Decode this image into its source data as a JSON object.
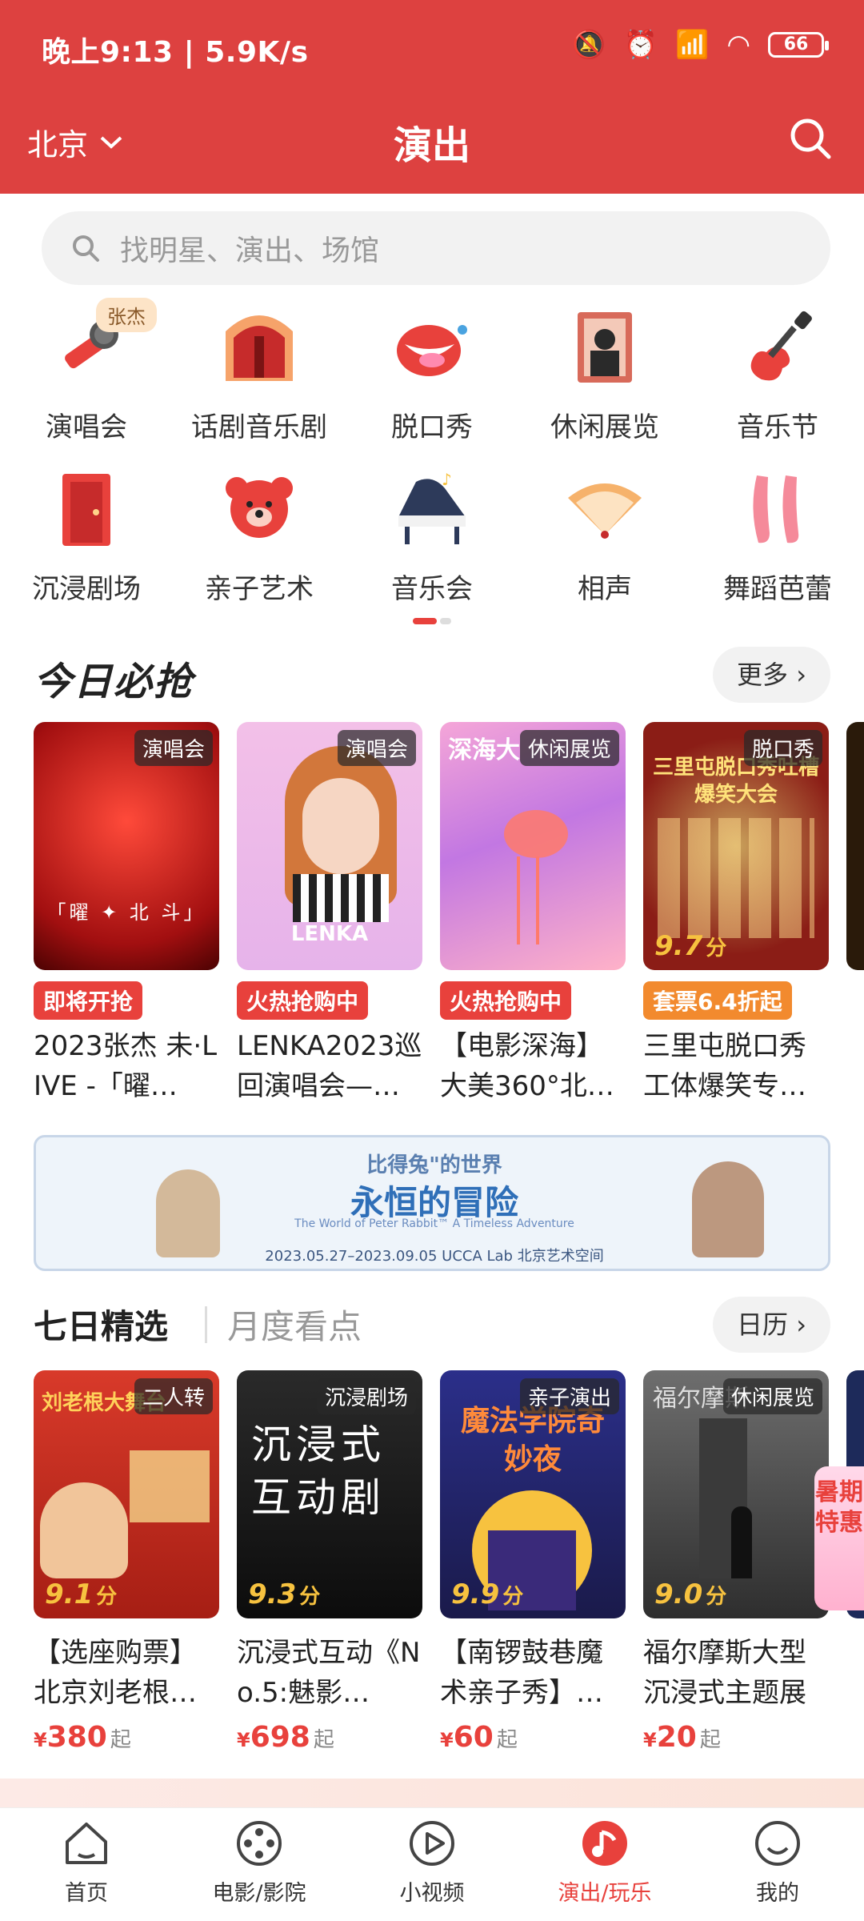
{
  "status_bar": {
    "time_speed": "晚上9:13 | 5.9K/s",
    "battery": "66"
  },
  "header": {
    "city": "北京",
    "title": "演出"
  },
  "search": {
    "placeholder": "找明星、演出、场馆"
  },
  "categories": [
    {
      "label": "演唱会",
      "badge": "张杰",
      "icon": "microphone-icon"
    },
    {
      "label": "话剧音乐剧",
      "icon": "stage-curtain-icon"
    },
    {
      "label": "脱口秀",
      "icon": "mouth-icon"
    },
    {
      "label": "休闲展览",
      "icon": "mona-lisa-frame-icon"
    },
    {
      "label": "音乐节",
      "icon": "electric-guitar-icon"
    },
    {
      "label": "沉浸剧场",
      "icon": "door-icon"
    },
    {
      "label": "亲子艺术",
      "icon": "bear-icon"
    },
    {
      "label": "音乐会",
      "icon": "piano-icon"
    },
    {
      "label": "相声",
      "icon": "fan-icon"
    },
    {
      "label": "舞蹈芭蕾",
      "icon": "ballet-shoes-icon"
    }
  ],
  "today": {
    "title": "今日必抢",
    "more": "更多",
    "cards": [
      {
        "tag": "演唱会",
        "status": "即将开抢",
        "title": "2023张杰 未·LIVE -「曜…",
        "poster_text": "「曜 ✦ 北 斗」"
      },
      {
        "tag": "演唱会",
        "status": "火热抢购中",
        "title": "LENKA2023巡回演唱会—…",
        "poster_text": "LENKA"
      },
      {
        "tag": "休闲展览",
        "status": "火热抢购中",
        "title": "【电影深海】大美360°北…",
        "poster_text": "深海大"
      },
      {
        "tag": "脱口秀",
        "status": "套票6.4折起",
        "title": "三里屯脱口秀工体爆笑专…",
        "poster_text": "三里屯脱口秀吐槽爆笑大会",
        "score": "9.7",
        "score_unit": "分"
      }
    ]
  },
  "banner": {
    "line1": "比得兔\"的世界",
    "line2": "永恒的冒险",
    "line3": "The World of Peter Rabbit™ A Timeless Adventure",
    "line4": "2023.05.27–2023.09.05  UCCA Lab 北京艺术空间"
  },
  "weekly": {
    "tab_active": "七日精选",
    "tab_inactive": "月度看点",
    "calendar": "日历",
    "summer_tag": "暑期特惠",
    "cards": [
      {
        "tag": "二人转",
        "score": "9.1",
        "score_unit": "分",
        "title": "【选座购票】北京刘老根…",
        "price": "380",
        "currency": "¥",
        "suffix": "起",
        "poster_text": "刘老根大舞台"
      },
      {
        "tag": "沉浸剧场",
        "score": "9.3",
        "score_unit": "分",
        "title": "沉浸式互动《No.5:魅影…",
        "price": "698",
        "currency": "¥",
        "suffix": "起",
        "poster_text": "沉浸式互动剧"
      },
      {
        "tag": "亲子演出",
        "score": "9.9",
        "score_unit": "分",
        "title": "【南锣鼓巷魔术亲子秀】…",
        "price": "60",
        "currency": "¥",
        "suffix": "起",
        "poster_text": "魔法学院奇妙夜"
      },
      {
        "tag": "休闲展览",
        "score": "9.0",
        "score_unit": "分",
        "title": "福尔摩斯大型沉浸式主题展",
        "price": "20",
        "currency": "¥",
        "suffix": "起",
        "poster_text": "福尔摩斯"
      }
    ]
  },
  "nav": [
    {
      "label": "首页",
      "icon": "home-icon"
    },
    {
      "label": "电影/影院",
      "icon": "film-reel-icon"
    },
    {
      "label": "小视频",
      "icon": "play-icon"
    },
    {
      "label": "演出/玩乐",
      "icon": "music-note-icon",
      "active": true
    },
    {
      "label": "我的",
      "icon": "profile-icon"
    }
  ],
  "colors": {
    "brand_red": "#dd4140",
    "accent": "#e8413c",
    "score_gold": "#f7c23f",
    "promo_orange": "#f28a2e"
  }
}
